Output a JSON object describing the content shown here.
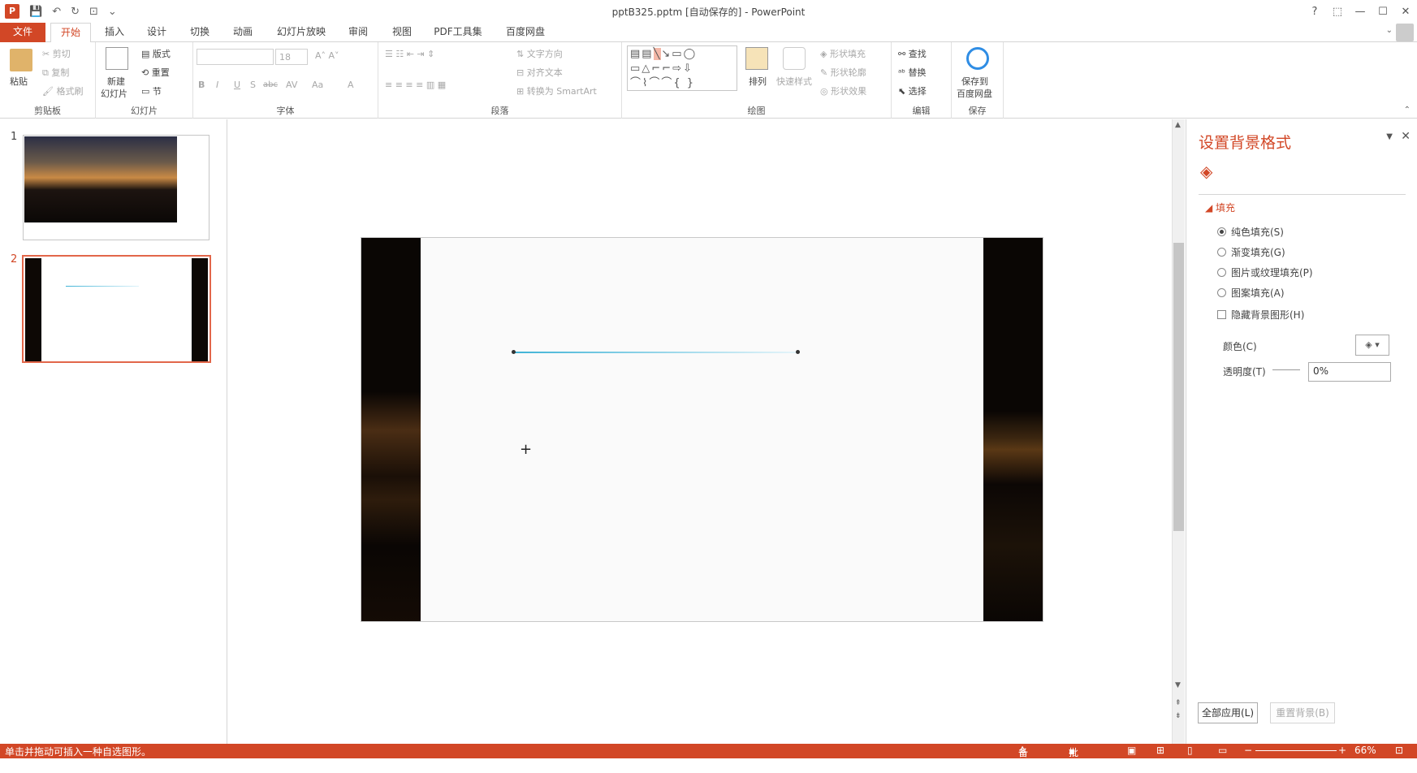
{
  "window": {
    "title": "pptB325.pptm [自动保存的] - PowerPoint",
    "logo": "P"
  },
  "qat": {
    "save": "💾",
    "undo": "↶",
    "redo": "↻",
    "present": "⊡",
    "more": "⌄"
  },
  "win_controls": {
    "help": "?",
    "restore_ribbon": "⬚",
    "minimize": "—",
    "maximize": "☐",
    "close": "✕"
  },
  "tabs": [
    "文件",
    "开始",
    "插入",
    "设计",
    "切换",
    "动画",
    "幻灯片放映",
    "审阅",
    "视图",
    "PDF工具集",
    "百度网盘"
  ],
  "ribbon": {
    "clipboard": {
      "label": "剪贴板",
      "paste": "粘贴",
      "cut": "剪切",
      "copy": "复制",
      "painter": "格式刷"
    },
    "slides": {
      "label": "幻灯片",
      "new_line1": "新建",
      "new_line2": "幻灯片",
      "layout": "版式",
      "reset": "重置",
      "section": "节"
    },
    "font": {
      "label": "字体",
      "font_name": "",
      "font_size": "18",
      "bold": "B",
      "italic": "I",
      "underline": "U",
      "shadow": "S",
      "strike": "abc",
      "spacing": "AV",
      "case": "Aa",
      "color": "A"
    },
    "paragraph": {
      "label": "段落",
      "text_direction": "文字方向",
      "align_text": "对齐文本",
      "smartart": "转换为 SmartArt"
    },
    "drawing": {
      "label": "绘图",
      "arrange": "排列",
      "quick_styles": "快速样式",
      "shape_fill": "形状填充",
      "shape_outline": "形状轮廓",
      "shape_effects": "形状效果"
    },
    "editing": {
      "label": "编辑",
      "find": "查找",
      "replace": "替换",
      "select": "选择"
    },
    "save": {
      "label": "保存",
      "save_line1": "保存到",
      "save_line2": "百度网盘"
    }
  },
  "slides_panel": [
    {
      "number": "1"
    },
    {
      "number": "2"
    }
  ],
  "format_pane": {
    "title": "设置背景格式",
    "section": "填充",
    "options": [
      "纯色填充(S)",
      "渐变填充(G)",
      "图片或纹理填充(P)",
      "图案填充(A)"
    ],
    "selected_option": 0,
    "hide_bg_graphics": "隐藏背景图形(H)",
    "color_label": "颜色(C)",
    "transparency_label": "透明度(T)",
    "transparency_value": "0%",
    "apply_all": "全部应用(L)",
    "reset_bg": "重置背景(B)"
  },
  "status": {
    "message": "单击并拖动可插入一种自选图形。",
    "notes": "备注",
    "comments": "批注",
    "zoom": "66%"
  },
  "colors": {
    "accent": "#d24726",
    "line": "#3fb3d6"
  }
}
